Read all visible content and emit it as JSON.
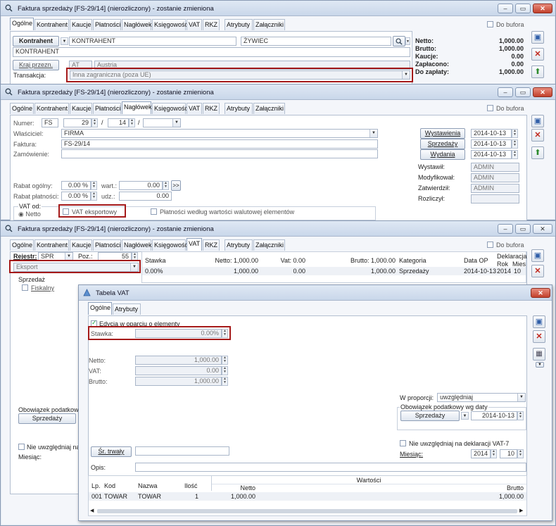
{
  "w1": {
    "title": "Faktura sprzedaży [FS-29/14] (nierozliczony) - zostanie zmieniona",
    "tabs": [
      "Ogólne",
      "Kontrahent",
      "Kaucje",
      "Płatności",
      "Nagłówek",
      "Księgowość",
      "VAT",
      "RKZ",
      "Atrybuty",
      "Załączniki"
    ],
    "do_bufora": "Do bufora",
    "kontrahent_btn": "Kontrahent",
    "kontrahent_code": "KONTRAHENT",
    "kontrahent_city": "ŻYWIEC",
    "kontrahent_name": "KONTRAHENT",
    "kraj_btn": "Kraj przezn.",
    "kraj_code": "AT",
    "kraj_name": "Austria",
    "transakcja_lbl": "Transakcja:",
    "transakcja_val": "Inna zagraniczna (poza UE)",
    "totals": [
      {
        "l": "Netto:",
        "v": "1,000.00"
      },
      {
        "l": "Brutto:",
        "v": "1,000.00"
      },
      {
        "l": "Kaucje:",
        "v": "0.00"
      },
      {
        "l": "Zapłacono:",
        "v": "0.00"
      },
      {
        "l": "Do zapłaty:",
        "v": "1,000.00"
      }
    ]
  },
  "w2": {
    "title": "Faktura sprzedaży [FS-29/14] (nierozliczony) - zostanie zmieniona",
    "numer_lbl": "Numer:",
    "numer_prefix": "FS",
    "numer_no": "29",
    "numer_year": "14",
    "wlasciciel_lbl": "Właściciel:",
    "wlasciciel_val": "FIRMA",
    "faktura_lbl": "Faktura:",
    "faktura_val": "FS-29/14",
    "zamowienie_lbl": "Zamówienie:",
    "wystawienia_btn": "Wystawienia",
    "wystawienia_date": "2014-10-13",
    "sprzedazy_btn": "Sprzedaży",
    "sprzedazy_date": "2014-10-13",
    "wydania_btn": "Wydania",
    "wydania_date": "2014-10-13",
    "wystawil_lbl": "Wystawił:",
    "wystawil_val": "ADMIN",
    "modyfikowal_lbl": "Modyfikował:",
    "modyfikowal_val": "ADMIN",
    "zatwierdzil_lbl": "Zatwierdził:",
    "zatwierdzil_val": "ADMIN",
    "rozliczyl_lbl": "Rozliczył:",
    "rabat_ogolny_lbl": "Rabat ogólny:",
    "rabat_ogolny_val": "0.00 %",
    "wart_lbl": "wart.:",
    "wart_val": "0.00",
    "rabat_platn_lbl": "Rabat płatności:",
    "rabat_platn_val": "0.00 %",
    "udz_lbl": "udz.:",
    "udz_val": "0.00",
    "vat_od_lbl": "VAT od:",
    "netto_radio": "Netto",
    "vat_eksport_lbl": "VAT eksportowy",
    "platnosci_wg_lbl": "Płatności według wartości walutowej elementów"
  },
  "w3": {
    "title": "Faktura sprzedaży [FS-29/14] (nierozliczony) - zostanie zmieniona",
    "rejestr_lbl": "Rejestr:",
    "rejestr_val": "SPR",
    "poz_lbl": "Poz.:",
    "poz_val": "55",
    "eksport_val": "Eksport",
    "sprzedaz_lbl": "Sprzedaż",
    "fiskalny_lbl": "Fiskalny",
    "obowiazek_lbl": "Obowiązek podatkowy w",
    "sprzedazy_btn": "Sprzedaży",
    "nie_uwzgl_lbl": "Nie uwzględniaj na d",
    "miesiac_lbl": "Miesiąc:",
    "grid_headers": {
      "stawka": "Stawka",
      "netto": "Netto: 1,000.00",
      "vat": "Vat: 0.00",
      "brutto": "Brutto: 1,000.00",
      "kategoria": "Kategoria",
      "data_op": "Data OP",
      "deklaracja": "Deklaracja",
      "rok": "Rok",
      "mies": "Mies"
    },
    "grid_row": {
      "stawka": "0.00%",
      "netto": "1,000.00",
      "vat": "0.00",
      "brutto": "1,000.00",
      "kategoria": "Sprzedaży",
      "data_op": "2014-10-13",
      "rok": "2014",
      "mies": "10"
    }
  },
  "w4": {
    "title": "Tabela VAT",
    "tabs": [
      "Ogólne",
      "Atrybuty"
    ],
    "edycja_lbl": "Edycja w oparciu o elementy",
    "stawka_lbl": "Stawka:",
    "stawka_val": "0.00%",
    "netto_lbl": "Netto:",
    "netto_val": "1,000.00",
    "vat_lbl": "VAT:",
    "vat_val": "0.00",
    "brutto_lbl": "Brutto:",
    "brutto_val": "1,000.00",
    "w_proporcji_lbl": "W proporcji:",
    "w_proporcji_val": "uwzględniaj",
    "obowiazek_lbl": "Obowiązek podatkowy wg daty",
    "sprzedazy_btn": "Sprzedaży",
    "obowiazek_date": "2014-10-13",
    "nie_uwzgl_lbl": "Nie uwzględniaj na deklaracji VAT-7",
    "miesiac_lbl": "Miesiąc:",
    "rok_val": "2014",
    "mies_val": "10",
    "sr_trwaly_btn": "Śr. trwały",
    "opis_lbl": "Opis:",
    "grid_headers": {
      "lp": "Lp.",
      "kod": "Kod",
      "nazwa": "Nazwa",
      "ilosc": "Ilość",
      "wartosci": "Wartości",
      "netto": "Netto",
      "brutto": "Brutto"
    },
    "grid_row": {
      "lp": "001",
      "kod": "TOWAR",
      "nazwa": "TOWAR",
      "ilosc": "1",
      "netto": "1,000.00",
      "brutto": "1,000.00"
    }
  }
}
